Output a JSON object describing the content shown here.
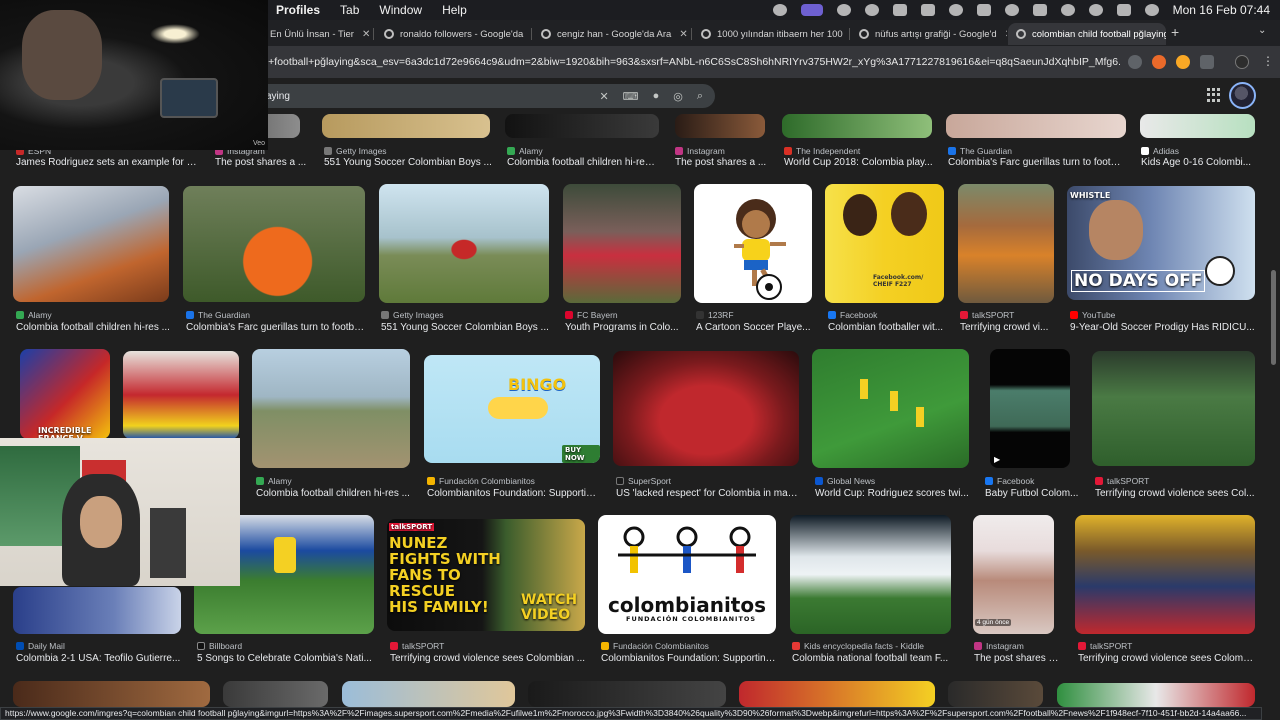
{
  "menubar": {
    "items": [
      "Profiles",
      "Tab",
      "Window",
      "Help"
    ],
    "clock": "Mon 16 Feb  07:44"
  },
  "tabs": [
    {
      "title": "En Ünlü İnsan - Tier"
    },
    {
      "title": "ronaldo followers - Google'da"
    },
    {
      "title": "cengiz han - Google'da Ara"
    },
    {
      "title": "1000 yılından itibaern her 100"
    },
    {
      "title": "nüfus artışı grafiği - Google'd"
    },
    {
      "title": "colombian child football pğlaying",
      "active": true
    }
  ],
  "address": {
    "url": "ld+football+pğlaying&sca_esv=6a3dc1d72e9664c9&udm=2&biw=1920&bih=963&sxsrf=ANbL-n6C6SsC8Sh6hNRIYrv375HW2r_xYg%3A1771227819616&ei=q8qSaeunJdXqhbIP_Mfg6..."
  },
  "search": {
    "query": "aying"
  },
  "webcam": {
    "badge": "Veo"
  },
  "results": [
    {
      "source": "ESPN",
      "title": "James Rodriguez sets an example for C...",
      "color": "#c62828"
    },
    {
      "source": "Instagram",
      "title": "The post shares a ...",
      "color": "#c13584"
    },
    {
      "source": "Getty Images",
      "title": "551 Young Soccer Colombian Boys ...",
      "color": "#777777"
    },
    {
      "source": "Alamy",
      "title": "Colombia football children hi-res ...",
      "color": "#34a853"
    },
    {
      "source": "Instagram",
      "title": "The post shares a ...",
      "color": "#c13584"
    },
    {
      "source": "The Independent",
      "title": "World Cup 2018: Colombia play...",
      "color": "#d93025"
    },
    {
      "source": "The Guardian",
      "title": "Colombia's Farc guerillas turn to footb...",
      "color": "#1a73e8"
    },
    {
      "source": "Adidas",
      "title": "Kids Age 0-16 Colombi...",
      "color": "#ffffff"
    },
    {
      "source": "Alamy",
      "title": "Colombia football children hi-res ...",
      "color": "#34a853"
    },
    {
      "source": "The Guardian",
      "title": "Colombia's Farc guerillas turn to footba...",
      "color": "#1a73e8"
    },
    {
      "source": "Getty Images",
      "title": "551 Young Soccer Colombian Boys ...",
      "color": "#777777"
    },
    {
      "source": "FC Bayern",
      "title": "Youth Programs in Colo...",
      "color": "#dc052d"
    },
    {
      "source": "123RF",
      "title": "A Cartoon Soccer Playe...",
      "color": "#333333"
    },
    {
      "source": "Facebook",
      "title": "Colombian footballer wit...",
      "color": "#1877f2"
    },
    {
      "source": "talkSPORT",
      "title": "Terrifying crowd vi...",
      "color": "#e31837"
    },
    {
      "source": "YouTube",
      "title": "9-Year-Old Soccer Prodigy Has RIDICU...",
      "color": "#ff0000"
    },
    {
      "source": "Alamy",
      "title": "Colombia football children hi-res ...",
      "color": "#34a853"
    },
    {
      "source": "Fundación Colombianitos",
      "title": "Colombianitos Foundation: Supportin...",
      "color": "#f4b400"
    },
    {
      "source": "SuperSport",
      "title": "US 'lacked respect' for Colombia in mau...",
      "color": "#1a1a1a"
    },
    {
      "source": "Global News",
      "title": "World Cup: Rodriguez scores twi...",
      "color": "#0b57d0"
    },
    {
      "source": "Facebook",
      "title": "Baby Futbol Colom...",
      "color": "#1877f2"
    },
    {
      "source": "talkSPORT",
      "title": "Terrifying crowd violence sees Col...",
      "color": "#e31837"
    },
    {
      "source": "Daily Mail",
      "title": "Colombia 2-1 USA: Teofilo Gutierre...",
      "color": "#004db3"
    },
    {
      "source": "Billboard",
      "title": "5 Songs to Celebrate Colombia's Nati...",
      "color": "#111111"
    },
    {
      "source": "talkSPORT",
      "title": "Terrifying crowd violence sees Colombian ...",
      "color": "#e31837"
    },
    {
      "source": "Fundación Colombianitos",
      "title": "Colombianitos Foundation: Supporting...",
      "color": "#f4b400"
    },
    {
      "source": "Kids encyclopedia facts - Kiddle",
      "title": "Colombia national football team F...",
      "color": "#e53935"
    },
    {
      "source": "Instagram",
      "title": "The post shares a ...",
      "color": "#c13584"
    },
    {
      "source": "talkSPORT",
      "title": "Terrifying crowd violence sees Colomb...",
      "color": "#e31837"
    }
  ],
  "tile_text": {
    "incredible": "INCREDIBLE\nFRANCE V",
    "bingo": "BINGO",
    "buy_now": "BUY NOW",
    "no_days_off": "NO DAYS OFF",
    "whistle": "WHISTLE",
    "nunez": "NUNEZ\nFIGHTS WITH\nFANS TO\nRESCUE\nHIS FAMILY!",
    "talksport_tag": "talkSPORT",
    "watch_video": "WATCH\nVIDEO",
    "colombianitos": "colombianitos",
    "fundacion": "FUNDACIÓN COLOMBIANITOS",
    "facebook_watermark": "Facebook.com/\nCHEIF F227",
    "gun_once": "4 gün önce"
  },
  "status_url": "https://www.google.com/imgres?q=colombian child football pğlaying&imgurl=https%3A%2F%2Fimages.supersport.com%2Fmedia%2Fufilwe1m%2Fmorocco.jpg%3Fwidth%3D3840%26quality%3D90%26format%3Dwebp&imgrefurl=https%3A%2F%2Fsupersport.com%2Ffootball%2Fnews%2F1f948ecf-7f10-451f-bb2d-14a4aa66..."
}
